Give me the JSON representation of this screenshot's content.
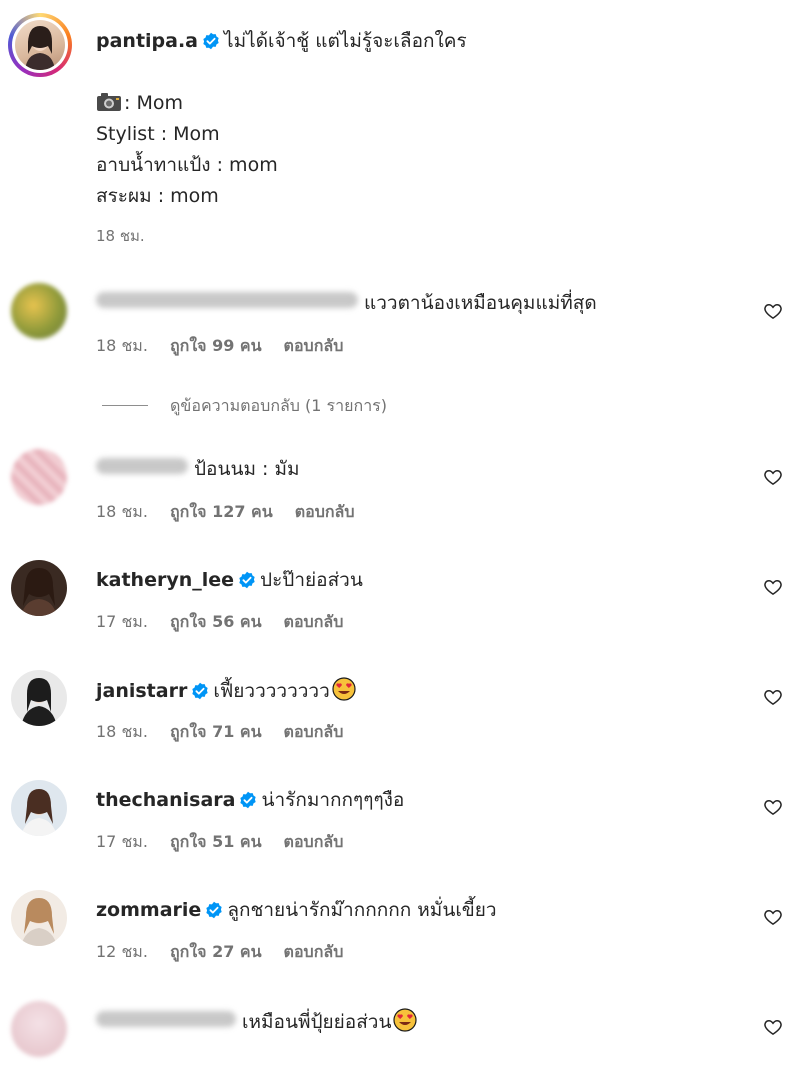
{
  "caption": {
    "username": "pantipa.a",
    "text": "ไม่ได้เจ้าชู้ แต่ไม่รู้จะเลือกใคร",
    "lines": [
      {
        "icon": "camera-icon",
        "text": ": Mom"
      },
      {
        "text": "Stylist : Mom"
      },
      {
        "text": "อาบน้ำทาแป้ง : mom"
      },
      {
        "text": "สระผม : mom"
      }
    ],
    "time": "18 ชม."
  },
  "view_replies": "ดูข้อความตอบกลับ (1 รายการ)",
  "reply_label": "ตอบกลับ",
  "comments": [
    {
      "username": "",
      "verified": false,
      "text": "แววตาน้องเหมือนคุมแม่ที่สุด",
      "time": "18 ชม.",
      "likes": "ถูกใจ 99 คน"
    },
    {
      "username": "",
      "verified": false,
      "text": "ป้อนนม : มัม",
      "time": "18 ชม.",
      "likes": "ถูกใจ 127 คน"
    },
    {
      "username": "katheryn_lee",
      "verified": true,
      "text": "ปะป๊าย่อส่วน",
      "time": "17 ชม.",
      "likes": "ถูกใจ 56 คน"
    },
    {
      "username": "janistarr",
      "verified": true,
      "text": "เฟี้ยวววววววว",
      "emoji": "heart-eyes-emoji",
      "time": "18 ชม.",
      "likes": "ถูกใจ 71 คน"
    },
    {
      "username": "thechanisara",
      "verified": true,
      "text": "น่ารักมากกๆๆๆงือ",
      "time": "17 ชม.",
      "likes": "ถูกใจ 51 คน"
    },
    {
      "username": "zommarie",
      "verified": true,
      "text": "ลูกชายน่ารักม๊ากกกกก หมั่นเขี้ยว",
      "time": "12 ชม.",
      "likes": "ถูกใจ 27 คน"
    },
    {
      "username": "",
      "verified": false,
      "text": "เหมือนพี่ปุ้ยย่อส่วน",
      "emoji": "heart-eyes-emoji",
      "time": "",
      "likes": ""
    }
  ],
  "colors": {
    "verified": "#0095f6",
    "text": "#262626",
    "meta": "#737373"
  }
}
